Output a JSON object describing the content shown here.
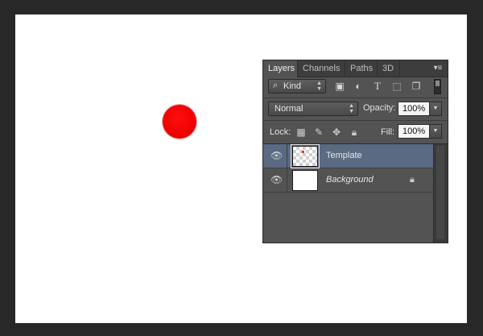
{
  "panel": {
    "tabs": [
      {
        "label": "Layers",
        "active": true
      },
      {
        "label": "Channels",
        "active": false
      },
      {
        "label": "Paths",
        "active": false
      },
      {
        "label": "3D",
        "active": false
      }
    ],
    "menu_icon": "panel-menu-icon",
    "filter": {
      "kind_label": "Kind",
      "icons": [
        "image-filter-icon",
        "adjustment-filter-icon",
        "type-filter-icon",
        "shape-filter-icon",
        "smart-object-filter-icon"
      ]
    },
    "blend_mode": "Normal",
    "opacity_label": "Opacity:",
    "opacity_value": "100%",
    "lock_label": "Lock:",
    "fill_label": "Fill:",
    "fill_value": "100%",
    "layers": [
      {
        "name": "Template",
        "selected": true,
        "visible": true,
        "locked": false
      },
      {
        "name": "Background",
        "selected": false,
        "visible": true,
        "locked": true
      }
    ]
  },
  "colors": {
    "canvas": "#ffffff",
    "workspace": "#282828",
    "circle": "#ff0000",
    "selection": "#5a6a82"
  }
}
